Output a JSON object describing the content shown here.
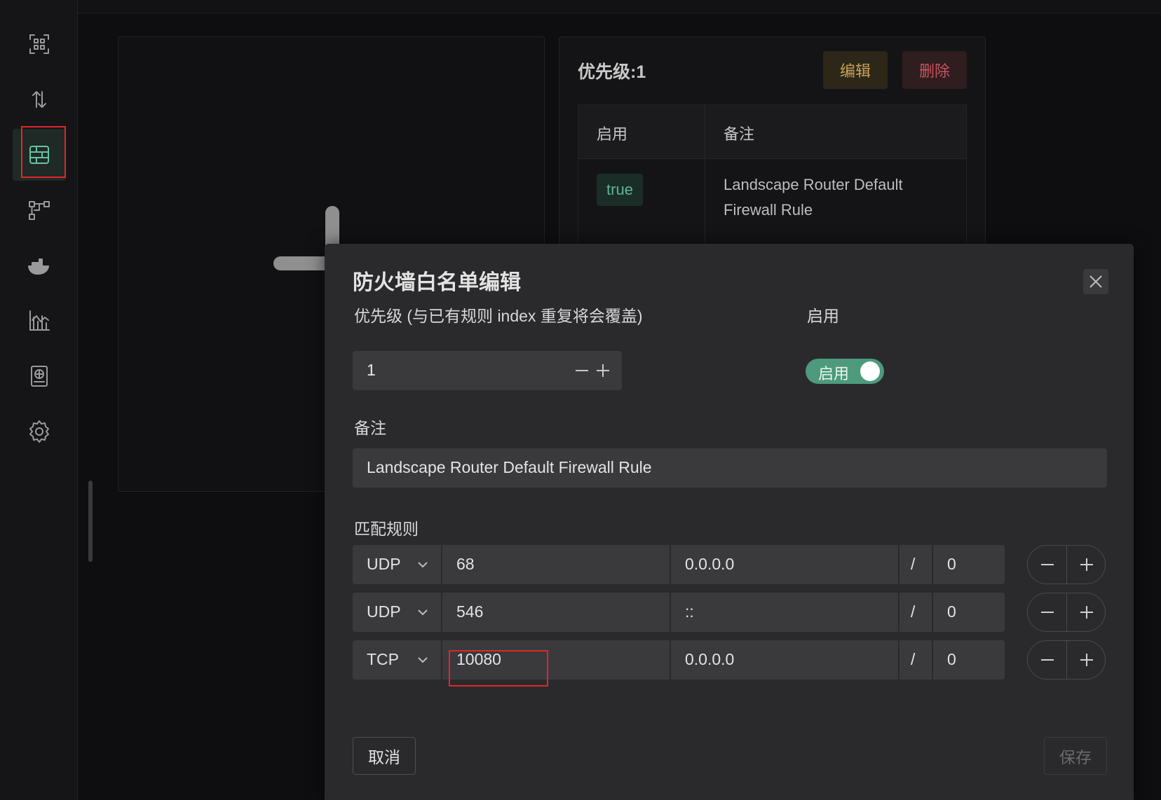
{
  "sidebar": {
    "items": [
      {
        "icon": "dashboard-grid-icon",
        "active": false
      },
      {
        "icon": "transfer-arrows-icon",
        "active": false
      },
      {
        "icon": "firewall-icon",
        "active": true
      },
      {
        "icon": "topology-icon",
        "active": false
      },
      {
        "icon": "docker-icon",
        "active": false
      },
      {
        "icon": "metrics-chart-icon",
        "active": false
      },
      {
        "icon": "dns-globe-icon",
        "active": false
      },
      {
        "icon": "settings-gear-icon",
        "active": false
      }
    ]
  },
  "background": {
    "rule_card": {
      "priority_label": "优先级:1",
      "edit_label": "编辑",
      "delete_label": "删除",
      "columns": [
        "启用",
        "备注"
      ],
      "enabled_tag": "true",
      "note": "Landscape Router Default Firewall Rule"
    }
  },
  "modal": {
    "title": "防火墙白名单编辑",
    "priority_label": "优先级 (与已有规则 index 重复将会覆盖)",
    "priority_value": "1",
    "enable_label": "启用",
    "enable_toggle_text": "启用",
    "enabled": true,
    "note_label": "备注",
    "note_value": "Landscape Router Default Firewall Rule",
    "match_label": "匹配规则",
    "rules": [
      {
        "protocol": "UDP",
        "port": "68",
        "ip": "0.0.0.0",
        "slash": "/",
        "mask": "0"
      },
      {
        "protocol": "UDP",
        "port": "546",
        "ip": "::",
        "slash": "/",
        "mask": "0"
      },
      {
        "protocol": "TCP",
        "port": "10080",
        "ip": "0.0.0.0",
        "slash": "/",
        "mask": "0"
      }
    ],
    "cancel_label": "取消",
    "save_label": "保存"
  },
  "colors": {
    "accent": "#4d9a7d",
    "highlight_box": "#e0262b",
    "edit": "#c8a255",
    "delete": "#c8545e"
  }
}
